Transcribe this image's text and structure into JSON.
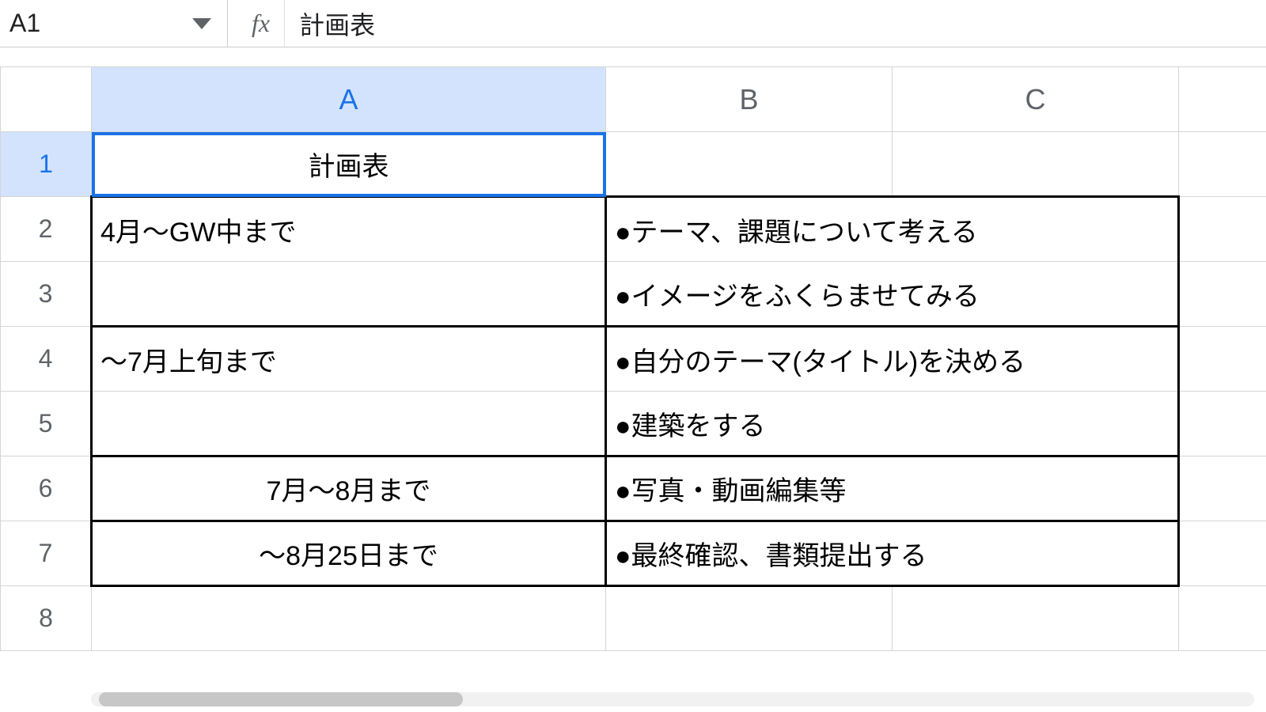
{
  "nameBox": "A1",
  "fxLabel": "fx",
  "formula": "計画表",
  "columns": [
    "A",
    "B",
    "C"
  ],
  "selectedColumn": "A",
  "selectedRow": 1,
  "rowHeaders": [
    "1",
    "2",
    "3",
    "4",
    "5",
    "6",
    "7",
    "8"
  ],
  "cells": {
    "A1": "計画表",
    "A2": "4月～GW中まで",
    "B2": "●テーマ、課題について考える",
    "B3": "●イメージをふくらませてみる",
    "A4": "～7月上旬まで",
    "B4": "●自分のテーマ(タイトル)を決める",
    "B5": "●建築をする",
    "A6": "7月～8月まで",
    "B6": "●写真・動画編集等",
    "A7": "～8月25日まで",
    "B7": "●最終確認、書類提出する"
  }
}
